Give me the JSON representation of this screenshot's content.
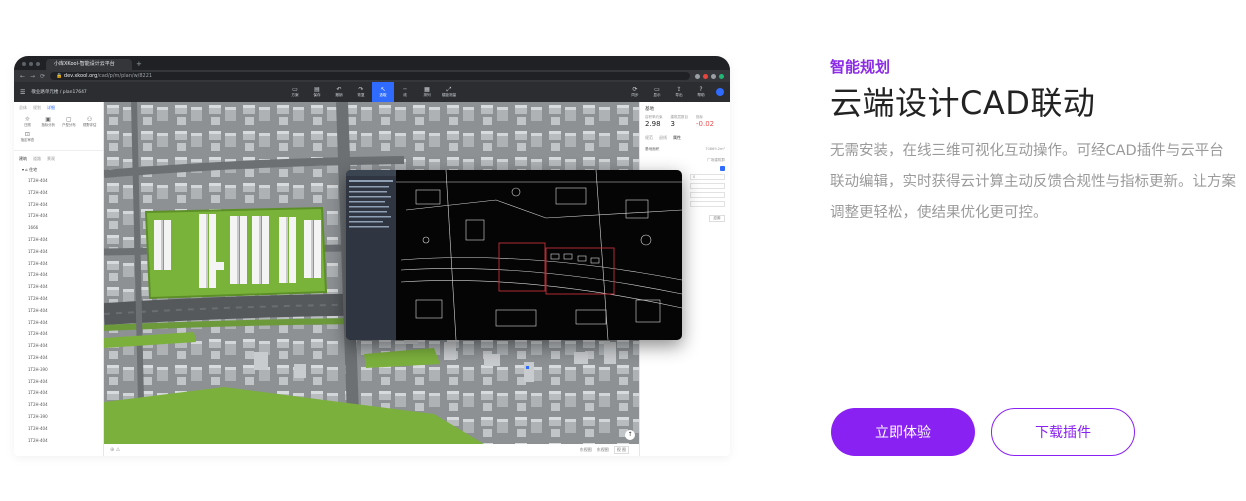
{
  "browser": {
    "tab_title": "小库XKool-智能设计云平台",
    "new_tab": "+",
    "url_host": "dev.xkool.org",
    "url_path": "/cad/p/m/plan/w/8221"
  },
  "app": {
    "breadcrumb": "敬业路单元楼  /  plan17647",
    "tools": [
      {
        "icon": "folder-icon",
        "glyph": "▭",
        "label": "方案"
      },
      {
        "icon": "save-icon",
        "glyph": "▤",
        "label": "保存"
      },
      {
        "icon": "undo-icon",
        "glyph": "↶",
        "label": "撤销"
      },
      {
        "icon": "redo-icon",
        "glyph": "↷",
        "label": "恢复"
      },
      {
        "icon": "select-icon",
        "glyph": "↖",
        "label": "选取"
      },
      {
        "icon": "line-icon",
        "glyph": "╌",
        "label": "线"
      },
      {
        "icon": "grid-icon",
        "glyph": "▦",
        "label": "排列"
      },
      {
        "icon": "measure-icon",
        "glyph": "⤢",
        "label": "楼距测量"
      }
    ],
    "tools_right": [
      {
        "icon": "sync-icon",
        "glyph": "⟳",
        "label": "同步"
      },
      {
        "icon": "display-icon",
        "glyph": "▭",
        "label": "显示"
      },
      {
        "icon": "export-icon",
        "glyph": "⇪",
        "label": "导出"
      },
      {
        "icon": "help-icon",
        "glyph": "?",
        "label": "帮助"
      }
    ]
  },
  "left_panel": {
    "tabs": [
      "总体",
      "规划",
      "详细"
    ],
    "icons": [
      {
        "glyph": "☼",
        "label": "日照"
      },
      {
        "glyph": "▣",
        "label": "指标分析"
      },
      {
        "glyph": "▢",
        "label": "户型分布"
      },
      {
        "glyph": "⚇",
        "label": "视野评估"
      },
      {
        "glyph": "⊡",
        "label": "指定审查"
      }
    ],
    "subtabs": [
      "建筑",
      "道路",
      "景观"
    ],
    "group_label": "住宅",
    "items": [
      "1T2H-404",
      "1T2H-404",
      "1T2H-404",
      "1T2H-404",
      "1666",
      "1T2H-404",
      "1T2H-404",
      "1T2H-404",
      "1T2H-404",
      "1T2H-404",
      "1T2H-404",
      "1T2H-404",
      "1T2H-404",
      "1T2H-404",
      "1T2H-404",
      "1T2H-404",
      "1T2H-390",
      "1T2H-404",
      "1T2H-404",
      "1T2H-404",
      "1T2H-390",
      "1T2H-404",
      "1T2H-404"
    ]
  },
  "right_panel": {
    "title": "基地",
    "stats": [
      {
        "key": "容积率约束",
        "value": "2.98",
        "red": false
      },
      {
        "key": "建筑层数目",
        "value": "3",
        "red": false
      },
      {
        "key": "指标",
        "value": "-0.02",
        "red": true
      }
    ],
    "tabs": [
      "规范",
      "退线",
      "属性"
    ],
    "area_label": "基地面积",
    "area_value": "70869.2m²",
    "check_label": "广场建筑群",
    "input_value": "0",
    "button_label": "应用"
  },
  "statusbar": {
    "items": [
      "东视图",
      "东视图",
      "视 图"
    ]
  },
  "marketing": {
    "eyebrow": "智能规划",
    "headline": "云端设计CAD联动",
    "description": "无需安装，在线三维可视化互动操作。可经CAD插件与云平台联动编辑，实时获得云计算主动反馈合规性与指标更新。让方案调整更轻松，使结果优化更可控。",
    "primary_button": "立即体验",
    "secondary_button": "下载插件"
  },
  "colors": {
    "accent": "#8a21f3",
    "eyebrow": "#8c2be6",
    "app_active": "#2f6bff"
  }
}
